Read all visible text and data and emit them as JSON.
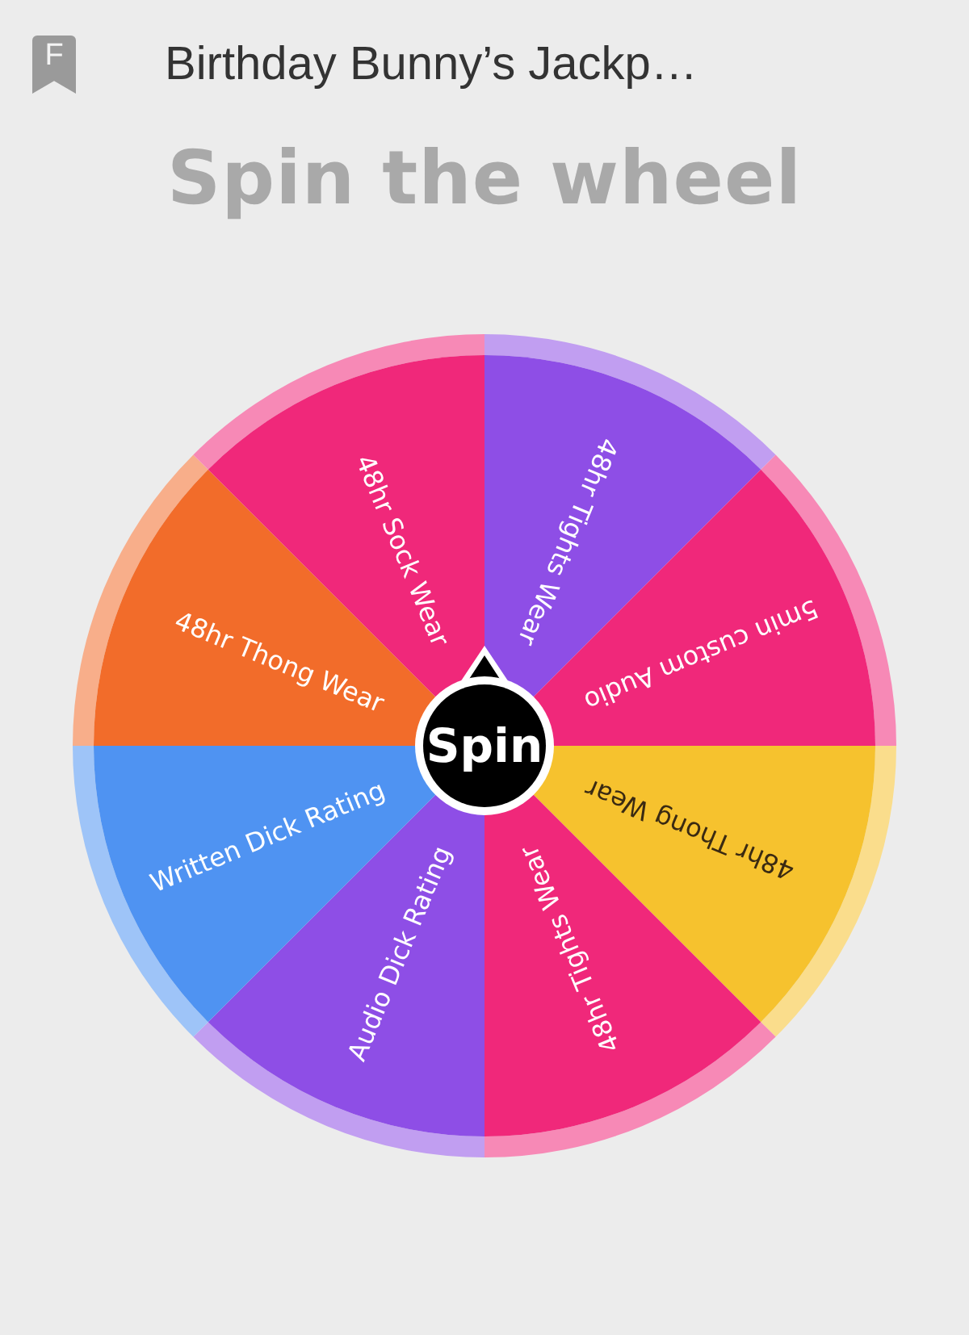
{
  "header": {
    "badge": "F",
    "title": "Birthday Bunny’s Jackp…"
  },
  "heading": "Spin the wheel",
  "wheel": {
    "button": "Spin",
    "segments": [
      {
        "label": "48hr Tights Wear",
        "color": "#8e4ee6"
      },
      {
        "label": "5min custom Audio",
        "color": "#f0287a"
      },
      {
        "label": "48hr Thong Wear",
        "color": "#f6c22e"
      },
      {
        "label": "48hr Tights Wear",
        "color": "#f0287a"
      },
      {
        "label": "Audio Dick Rating",
        "color": "#8e4ee6"
      },
      {
        "label": "Written Dick Rating",
        "color": "#4f93f2"
      },
      {
        "label": "48hr Thong Wear",
        "color": "#f26c2a"
      },
      {
        "label": "48hr Sock Wear",
        "color": "#f0287a"
      }
    ]
  }
}
